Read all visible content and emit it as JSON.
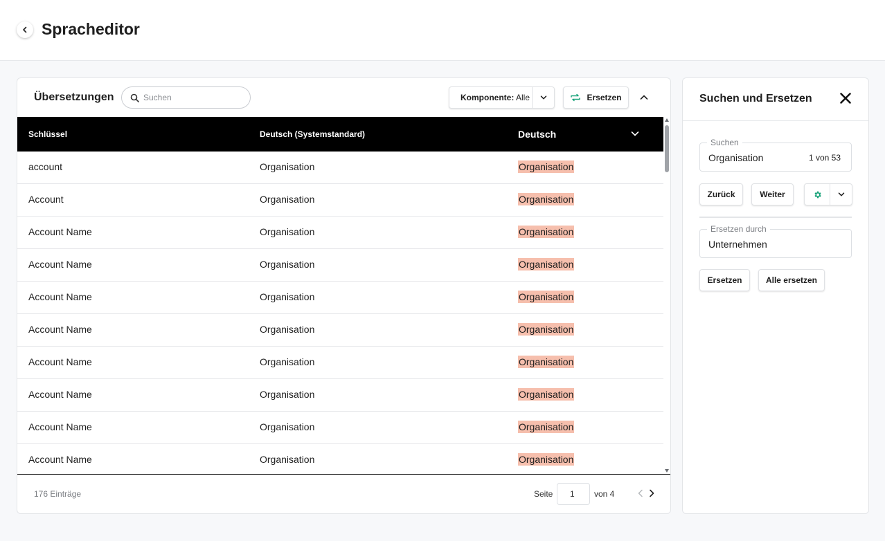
{
  "header": {
    "title": "Spracheditor"
  },
  "translations": {
    "title": "Übersetzungen",
    "search_placeholder": "Suchen",
    "component_label": "Komponente:",
    "component_value": "Alle",
    "replace_label": "Ersetzen",
    "columns": {
      "key": "Schlüssel",
      "default": "Deutsch (Systemstandard)",
      "german": "Deutsch"
    },
    "rows": [
      {
        "key": "account",
        "default": "Organisation",
        "german": "Organisation"
      },
      {
        "key": "Account",
        "default": "Organisation",
        "german": "Organisation"
      },
      {
        "key": "Account Name",
        "default": "Organisation",
        "german": "Organisation"
      },
      {
        "key": "Account Name",
        "default": "Organisation",
        "german": "Organisation"
      },
      {
        "key": "Account Name",
        "default": "Organisation",
        "german": "Organisation"
      },
      {
        "key": "Account Name",
        "default": "Organisation",
        "german": "Organisation"
      },
      {
        "key": "Account Name",
        "default": "Organisation",
        "german": "Organisation"
      },
      {
        "key": "Account Name",
        "default": "Organisation",
        "german": "Organisation"
      },
      {
        "key": "Account Name",
        "default": "Organisation",
        "german": "Organisation"
      },
      {
        "key": "Account Name",
        "default": "Organisation",
        "german": "Organisation"
      }
    ],
    "footer": {
      "count": "176 Einträge",
      "page_label": "Seite",
      "page_value": "1",
      "page_of": "von 4"
    }
  },
  "search_replace": {
    "title": "Suchen und Ersetzen",
    "search_label": "Suchen",
    "search_value": "Organisation",
    "match_count": "1 von 53",
    "back_label": "Zurück",
    "next_label": "Weiter",
    "replace_with_label": "Ersetzen durch",
    "replace_with_value": "Unternehmen",
    "replace_label": "Ersetzen",
    "replace_all_label": "Alle ersetzen"
  },
  "colors": {
    "accent": "#1aa37a",
    "highlight": "#f6bfad",
    "header_bg": "#000000"
  }
}
